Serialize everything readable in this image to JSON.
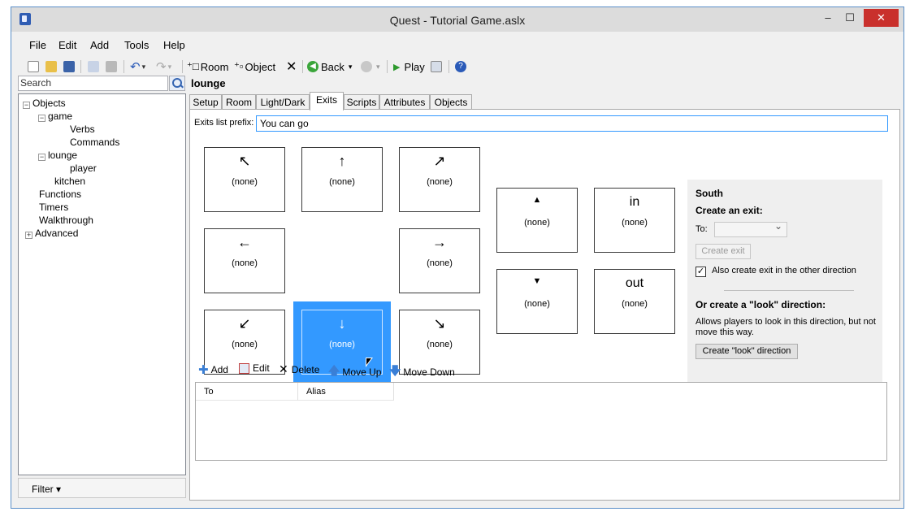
{
  "window": {
    "title": "Quest - Tutorial Game.aslx"
  },
  "window_controls": {
    "minimize": "–",
    "maximize": "☐",
    "close": "✕"
  },
  "menu": [
    "File",
    "Edit",
    "Add",
    "Tools",
    "Help"
  ],
  "toolbar": {
    "room_label": "Room",
    "object_label": "Object",
    "back_label": "Back",
    "play_label": "Play"
  },
  "sidebar": {
    "search_placeholder": "Search",
    "tree": [
      {
        "label": "Objects"
      },
      {
        "label": "game"
      },
      {
        "label": "Verbs"
      },
      {
        "label": "Commands"
      },
      {
        "label": "lounge"
      },
      {
        "label": "player"
      },
      {
        "label": "kitchen"
      },
      {
        "label": "Functions"
      },
      {
        "label": "Timers"
      },
      {
        "label": "Walkthrough"
      },
      {
        "label": "Advanced"
      }
    ],
    "filter_label": "Filter ▾"
  },
  "editor": {
    "room_name": "lounge",
    "tabs": [
      "Setup",
      "Room",
      "Light/Dark",
      "Exits",
      "Scripts",
      "Attributes",
      "Objects"
    ],
    "active_tab": "Exits",
    "exits_prefix_label": "Exits list prefix:",
    "exits_prefix_value": "You can go",
    "directions": {
      "northwest": {
        "arrow": "↖",
        "value": "(none)"
      },
      "north": {
        "arrow": "↑",
        "value": "(none)"
      },
      "northeast": {
        "arrow": "↗",
        "value": "(none)"
      },
      "west": {
        "arrow": "←",
        "value": "(none)"
      },
      "east": {
        "arrow": "→",
        "value": "(none)"
      },
      "southwest": {
        "arrow": "↙",
        "value": "(none)"
      },
      "south": {
        "arrow": "↓",
        "value": "(none)"
      },
      "southeast": {
        "arrow": "↘",
        "value": "(none)"
      },
      "up": {
        "arrow": "▲",
        "value": "(none)"
      },
      "down": {
        "arrow": "▼",
        "value": "(none)"
      },
      "in": {
        "word": "in",
        "value": "(none)"
      },
      "out": {
        "word": "out",
        "value": "(none)"
      }
    },
    "selected_direction": "south",
    "side_panel": {
      "heading": "South",
      "create_exit_heading": "Create an exit:",
      "to_label": "To:",
      "to_value": "",
      "create_exit_button": "Create exit",
      "also_create_label": "Also create exit in the other direction",
      "also_create_checked": true,
      "look_heading": "Or create a \"look\" direction:",
      "look_desc_line1": "Allows players to look in this direction, but not",
      "look_desc_line2": "move this way.",
      "look_button": "Create \"look\" direction"
    },
    "exits_toolbar": {
      "add": "Add",
      "edit": "Edit",
      "delete": "Delete",
      "move_up": "Move Up",
      "move_down": "Move Down"
    },
    "exits_table": {
      "columns": [
        "To",
        "Alias"
      ],
      "rows": []
    }
  }
}
